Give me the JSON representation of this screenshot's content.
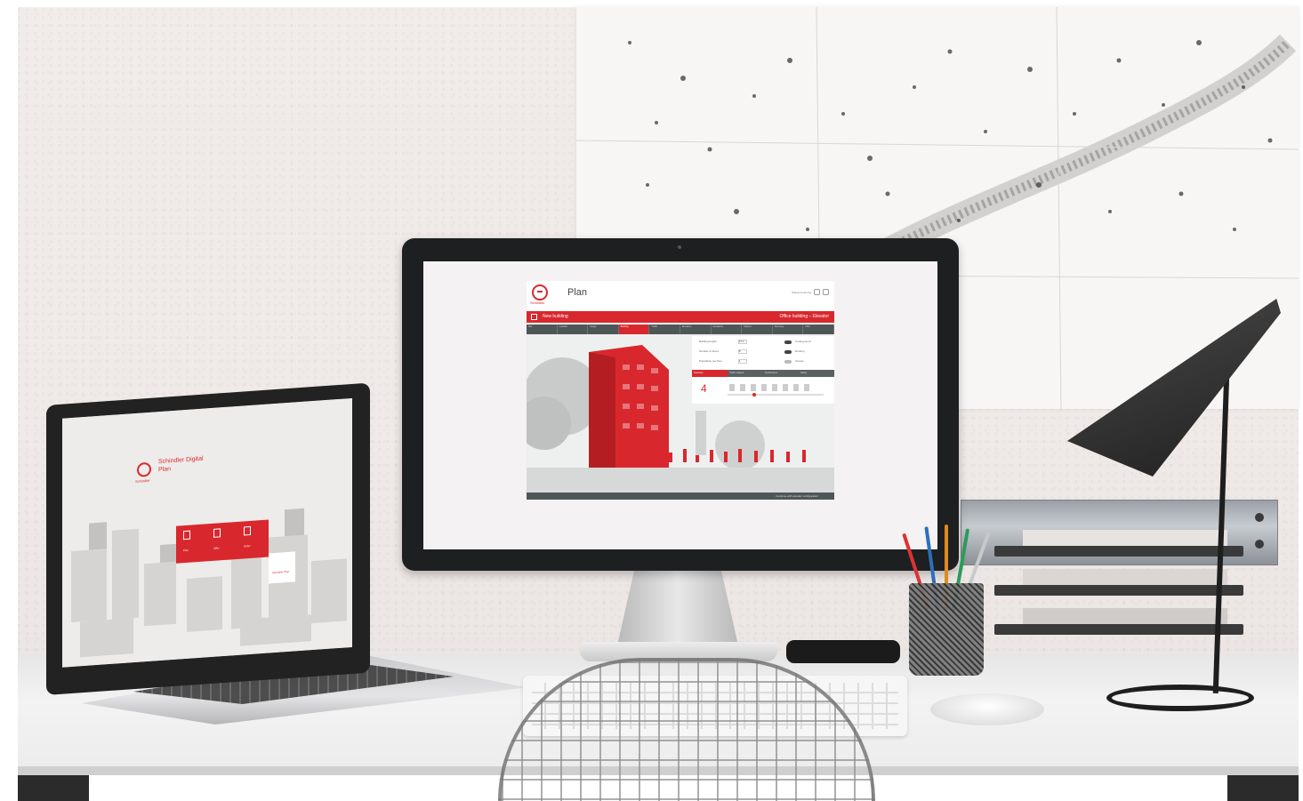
{
  "monitor_app": {
    "brand": "Schindler",
    "title": "Plan",
    "header_links": "Welcome Emma",
    "red_bar_left": "New building",
    "red_bar_right": "Office building – Elevator",
    "steps": [
      "Site",
      "Location",
      "Usage",
      "Building",
      "Traffic",
      "Elevators",
      "Escalators",
      "Options",
      "Summary",
      "Offer"
    ],
    "config_labels": [
      "Building height",
      "Number of floors",
      "Population per floor"
    ],
    "config_values": [
      "17 m",
      "5",
      "1"
    ],
    "toggles": [
      "Underground",
      "Rooftop",
      "Access"
    ],
    "mini_tabs": [
      "Overview",
      "Traffic analysis",
      "Performance",
      "Safety"
    ],
    "floor_count": "4",
    "footer_action": "Continue with elevator configuration"
  },
  "laptop_app": {
    "brand": "Schindler",
    "title": "Schindler Digital Plan",
    "tiles": [
      "Plan",
      "Offer",
      "Order"
    ],
    "card": "Schindler Plan"
  },
  "colors": {
    "accent": "#d8282e",
    "dark": "#4f5658"
  }
}
